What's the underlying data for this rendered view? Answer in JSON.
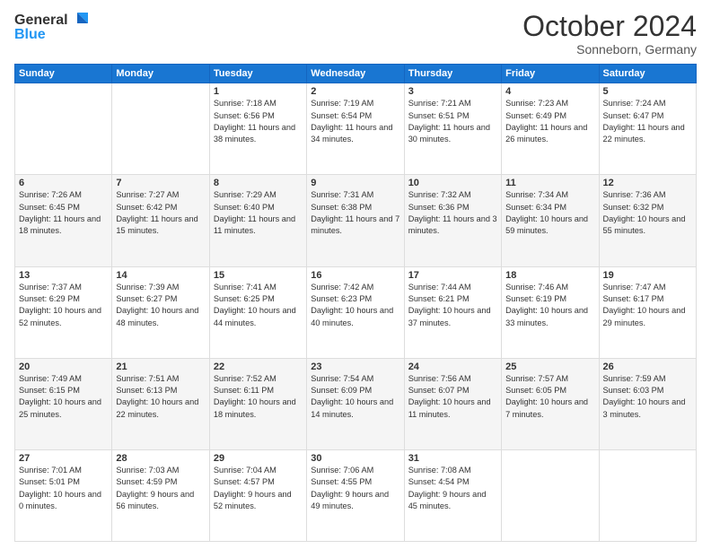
{
  "header": {
    "logo_general": "General",
    "logo_blue": "Blue",
    "month": "October 2024",
    "location": "Sonneborn, Germany"
  },
  "weekdays": [
    "Sunday",
    "Monday",
    "Tuesday",
    "Wednesday",
    "Thursday",
    "Friday",
    "Saturday"
  ],
  "weeks": [
    [
      {
        "date": "",
        "info": ""
      },
      {
        "date": "",
        "info": ""
      },
      {
        "date": "1",
        "info": "Sunrise: 7:18 AM\nSunset: 6:56 PM\nDaylight: 11 hours and 38 minutes."
      },
      {
        "date": "2",
        "info": "Sunrise: 7:19 AM\nSunset: 6:54 PM\nDaylight: 11 hours and 34 minutes."
      },
      {
        "date": "3",
        "info": "Sunrise: 7:21 AM\nSunset: 6:51 PM\nDaylight: 11 hours and 30 minutes."
      },
      {
        "date": "4",
        "info": "Sunrise: 7:23 AM\nSunset: 6:49 PM\nDaylight: 11 hours and 26 minutes."
      },
      {
        "date": "5",
        "info": "Sunrise: 7:24 AM\nSunset: 6:47 PM\nDaylight: 11 hours and 22 minutes."
      }
    ],
    [
      {
        "date": "6",
        "info": "Sunrise: 7:26 AM\nSunset: 6:45 PM\nDaylight: 11 hours and 18 minutes."
      },
      {
        "date": "7",
        "info": "Sunrise: 7:27 AM\nSunset: 6:42 PM\nDaylight: 11 hours and 15 minutes."
      },
      {
        "date": "8",
        "info": "Sunrise: 7:29 AM\nSunset: 6:40 PM\nDaylight: 11 hours and 11 minutes."
      },
      {
        "date": "9",
        "info": "Sunrise: 7:31 AM\nSunset: 6:38 PM\nDaylight: 11 hours and 7 minutes."
      },
      {
        "date": "10",
        "info": "Sunrise: 7:32 AM\nSunset: 6:36 PM\nDaylight: 11 hours and 3 minutes."
      },
      {
        "date": "11",
        "info": "Sunrise: 7:34 AM\nSunset: 6:34 PM\nDaylight: 10 hours and 59 minutes."
      },
      {
        "date": "12",
        "info": "Sunrise: 7:36 AM\nSunset: 6:32 PM\nDaylight: 10 hours and 55 minutes."
      }
    ],
    [
      {
        "date": "13",
        "info": "Sunrise: 7:37 AM\nSunset: 6:29 PM\nDaylight: 10 hours and 52 minutes."
      },
      {
        "date": "14",
        "info": "Sunrise: 7:39 AM\nSunset: 6:27 PM\nDaylight: 10 hours and 48 minutes."
      },
      {
        "date": "15",
        "info": "Sunrise: 7:41 AM\nSunset: 6:25 PM\nDaylight: 10 hours and 44 minutes."
      },
      {
        "date": "16",
        "info": "Sunrise: 7:42 AM\nSunset: 6:23 PM\nDaylight: 10 hours and 40 minutes."
      },
      {
        "date": "17",
        "info": "Sunrise: 7:44 AM\nSunset: 6:21 PM\nDaylight: 10 hours and 37 minutes."
      },
      {
        "date": "18",
        "info": "Sunrise: 7:46 AM\nSunset: 6:19 PM\nDaylight: 10 hours and 33 minutes."
      },
      {
        "date": "19",
        "info": "Sunrise: 7:47 AM\nSunset: 6:17 PM\nDaylight: 10 hours and 29 minutes."
      }
    ],
    [
      {
        "date": "20",
        "info": "Sunrise: 7:49 AM\nSunset: 6:15 PM\nDaylight: 10 hours and 25 minutes."
      },
      {
        "date": "21",
        "info": "Sunrise: 7:51 AM\nSunset: 6:13 PM\nDaylight: 10 hours and 22 minutes."
      },
      {
        "date": "22",
        "info": "Sunrise: 7:52 AM\nSunset: 6:11 PM\nDaylight: 10 hours and 18 minutes."
      },
      {
        "date": "23",
        "info": "Sunrise: 7:54 AM\nSunset: 6:09 PM\nDaylight: 10 hours and 14 minutes."
      },
      {
        "date": "24",
        "info": "Sunrise: 7:56 AM\nSunset: 6:07 PM\nDaylight: 10 hours and 11 minutes."
      },
      {
        "date": "25",
        "info": "Sunrise: 7:57 AM\nSunset: 6:05 PM\nDaylight: 10 hours and 7 minutes."
      },
      {
        "date": "26",
        "info": "Sunrise: 7:59 AM\nSunset: 6:03 PM\nDaylight: 10 hours and 3 minutes."
      }
    ],
    [
      {
        "date": "27",
        "info": "Sunrise: 7:01 AM\nSunset: 5:01 PM\nDaylight: 10 hours and 0 minutes."
      },
      {
        "date": "28",
        "info": "Sunrise: 7:03 AM\nSunset: 4:59 PM\nDaylight: 9 hours and 56 minutes."
      },
      {
        "date": "29",
        "info": "Sunrise: 7:04 AM\nSunset: 4:57 PM\nDaylight: 9 hours and 52 minutes."
      },
      {
        "date": "30",
        "info": "Sunrise: 7:06 AM\nSunset: 4:55 PM\nDaylight: 9 hours and 49 minutes."
      },
      {
        "date": "31",
        "info": "Sunrise: 7:08 AM\nSunset: 4:54 PM\nDaylight: 9 hours and 45 minutes."
      },
      {
        "date": "",
        "info": ""
      },
      {
        "date": "",
        "info": ""
      }
    ]
  ]
}
